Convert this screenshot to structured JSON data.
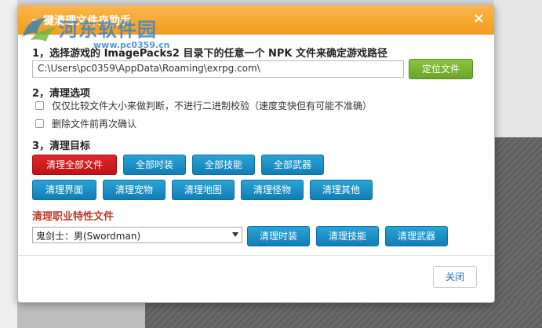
{
  "dialog": {
    "title": "一键清理文件夹助手",
    "close_glyph": "×"
  },
  "watermark": {
    "site_name": "河东软件园",
    "url": "www.pc0359.cn"
  },
  "step1": {
    "label": "1，选择游戏的 ImagePacks2 目录下的任意一个 NPK 文件来确定游戏路径",
    "path_value": "C:\\Users\\pc0359\\AppData\\Roaming\\exrpg.com\\",
    "locate_button": "定位文件"
  },
  "step2": {
    "label": "2，清理选项",
    "options": [
      {
        "text": "仅仅比较文件大小来做判断，不进行二进制校验（速度变快但有可能不准确）",
        "checked": false
      },
      {
        "text": "删除文件前再次确认",
        "checked": false
      }
    ]
  },
  "step3": {
    "label": "3，清理目标",
    "row1": [
      "清理全部文件",
      "全部时装",
      "全部技能",
      "全部武器"
    ],
    "row2": [
      "清理界面",
      "清理宠物",
      "清理地图",
      "清理怪物",
      "清理其他"
    ]
  },
  "profession": {
    "label": "清理职业特性文件",
    "selected": "鬼剑士：男(Swordman)",
    "buttons": [
      "清理时装",
      "清理技能",
      "清理武器"
    ]
  },
  "footer": {
    "close_button": "关闭"
  },
  "colors": {
    "title_bar": "#f5a623",
    "primary_blue": "#1a8fc7",
    "danger_red": "#d11a1f",
    "locate_green": "#7ab833",
    "profession_label": "#c0392b"
  }
}
